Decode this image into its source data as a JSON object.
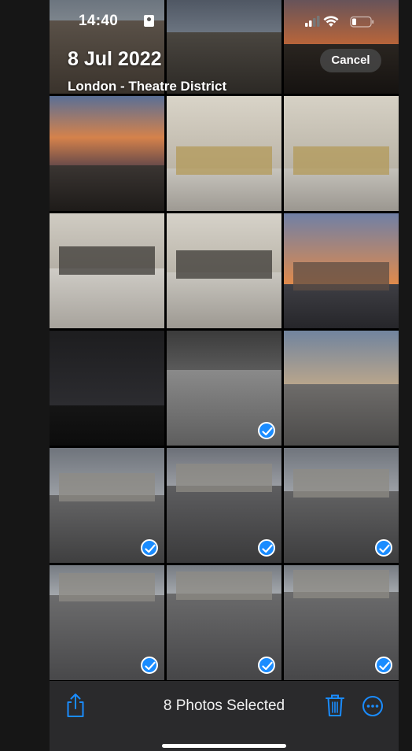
{
  "status_bar": {
    "time": "14:40"
  },
  "header": {
    "date": "8 Jul 2022",
    "location": "London - Theatre District",
    "cancel_label": "Cancel"
  },
  "photos": [
    {
      "name": "photo-railway-tracks",
      "selected": false
    },
    {
      "name": "photo-railway-sky",
      "selected": false
    },
    {
      "name": "photo-sunset-rooftops",
      "selected": false
    },
    {
      "name": "photo-sunset-square",
      "selected": false
    },
    {
      "name": "photo-group-building-1",
      "selected": false
    },
    {
      "name": "photo-group-building-2",
      "selected": false
    },
    {
      "name": "photo-group-columns-1",
      "selected": false
    },
    {
      "name": "photo-group-columns-2",
      "selected": false
    },
    {
      "name": "photo-street-dusk",
      "selected": false
    },
    {
      "name": "photo-cinema-screen",
      "selected": false
    },
    {
      "name": "photo-stage-set",
      "selected": true
    },
    {
      "name": "photo-square-monument",
      "selected": false
    },
    {
      "name": "photo-admiralty-arch-1",
      "selected": true
    },
    {
      "name": "photo-admiralty-arch-2",
      "selected": true
    },
    {
      "name": "photo-admiralty-arch-3",
      "selected": true
    },
    {
      "name": "photo-admiralty-arch-4",
      "selected": true
    },
    {
      "name": "photo-admiralty-arch-5",
      "selected": true
    },
    {
      "name": "photo-admiralty-arch-6",
      "selected": true
    }
  ],
  "toolbar": {
    "selection_label": "8 Photos Selected",
    "share_icon": "share-icon",
    "trash_icon": "trash-icon",
    "more_icon": "more-icon"
  },
  "colors": {
    "accent": "#1a8cff",
    "toolbar_bg": "#2a2a2c"
  }
}
